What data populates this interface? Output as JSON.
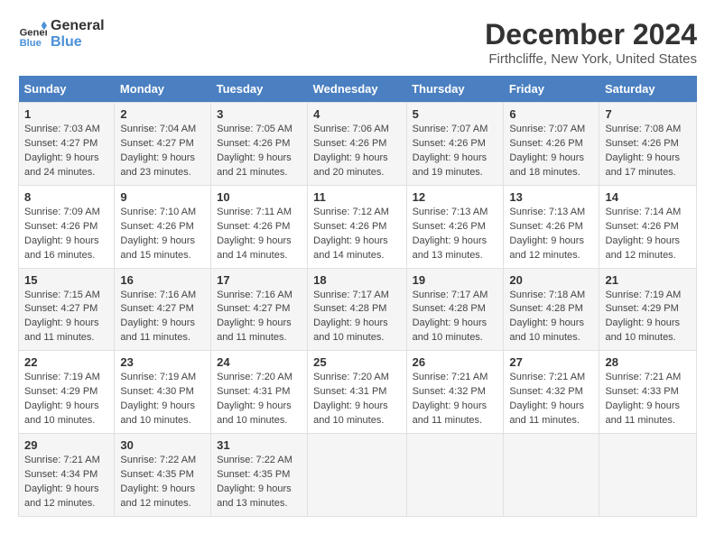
{
  "logo": {
    "line1": "General",
    "line2": "Blue"
  },
  "title": "December 2024",
  "subtitle": "Firthcliffe, New York, United States",
  "days_of_week": [
    "Sunday",
    "Monday",
    "Tuesday",
    "Wednesday",
    "Thursday",
    "Friday",
    "Saturday"
  ],
  "weeks": [
    [
      {
        "day": "1",
        "sunrise": "7:03 AM",
        "sunset": "4:27 PM",
        "daylight": "9 hours and 24 minutes."
      },
      {
        "day": "2",
        "sunrise": "7:04 AM",
        "sunset": "4:27 PM",
        "daylight": "9 hours and 23 minutes."
      },
      {
        "day": "3",
        "sunrise": "7:05 AM",
        "sunset": "4:26 PM",
        "daylight": "9 hours and 21 minutes."
      },
      {
        "day": "4",
        "sunrise": "7:06 AM",
        "sunset": "4:26 PM",
        "daylight": "9 hours and 20 minutes."
      },
      {
        "day": "5",
        "sunrise": "7:07 AM",
        "sunset": "4:26 PM",
        "daylight": "9 hours and 19 minutes."
      },
      {
        "day": "6",
        "sunrise": "7:07 AM",
        "sunset": "4:26 PM",
        "daylight": "9 hours and 18 minutes."
      },
      {
        "day": "7",
        "sunrise": "7:08 AM",
        "sunset": "4:26 PM",
        "daylight": "9 hours and 17 minutes."
      }
    ],
    [
      {
        "day": "8",
        "sunrise": "7:09 AM",
        "sunset": "4:26 PM",
        "daylight": "9 hours and 16 minutes."
      },
      {
        "day": "9",
        "sunrise": "7:10 AM",
        "sunset": "4:26 PM",
        "daylight": "9 hours and 15 minutes."
      },
      {
        "day": "10",
        "sunrise": "7:11 AM",
        "sunset": "4:26 PM",
        "daylight": "9 hours and 14 minutes."
      },
      {
        "day": "11",
        "sunrise": "7:12 AM",
        "sunset": "4:26 PM",
        "daylight": "9 hours and 14 minutes."
      },
      {
        "day": "12",
        "sunrise": "7:13 AM",
        "sunset": "4:26 PM",
        "daylight": "9 hours and 13 minutes."
      },
      {
        "day": "13",
        "sunrise": "7:13 AM",
        "sunset": "4:26 PM",
        "daylight": "9 hours and 12 minutes."
      },
      {
        "day": "14",
        "sunrise": "7:14 AM",
        "sunset": "4:26 PM",
        "daylight": "9 hours and 12 minutes."
      }
    ],
    [
      {
        "day": "15",
        "sunrise": "7:15 AM",
        "sunset": "4:27 PM",
        "daylight": "9 hours and 11 minutes."
      },
      {
        "day": "16",
        "sunrise": "7:16 AM",
        "sunset": "4:27 PM",
        "daylight": "9 hours and 11 minutes."
      },
      {
        "day": "17",
        "sunrise": "7:16 AM",
        "sunset": "4:27 PM",
        "daylight": "9 hours and 11 minutes."
      },
      {
        "day": "18",
        "sunrise": "7:17 AM",
        "sunset": "4:28 PM",
        "daylight": "9 hours and 10 minutes."
      },
      {
        "day": "19",
        "sunrise": "7:17 AM",
        "sunset": "4:28 PM",
        "daylight": "9 hours and 10 minutes."
      },
      {
        "day": "20",
        "sunrise": "7:18 AM",
        "sunset": "4:28 PM",
        "daylight": "9 hours and 10 minutes."
      },
      {
        "day": "21",
        "sunrise": "7:19 AM",
        "sunset": "4:29 PM",
        "daylight": "9 hours and 10 minutes."
      }
    ],
    [
      {
        "day": "22",
        "sunrise": "7:19 AM",
        "sunset": "4:29 PM",
        "daylight": "9 hours and 10 minutes."
      },
      {
        "day": "23",
        "sunrise": "7:19 AM",
        "sunset": "4:30 PM",
        "daylight": "9 hours and 10 minutes."
      },
      {
        "day": "24",
        "sunrise": "7:20 AM",
        "sunset": "4:31 PM",
        "daylight": "9 hours and 10 minutes."
      },
      {
        "day": "25",
        "sunrise": "7:20 AM",
        "sunset": "4:31 PM",
        "daylight": "9 hours and 10 minutes."
      },
      {
        "day": "26",
        "sunrise": "7:21 AM",
        "sunset": "4:32 PM",
        "daylight": "9 hours and 11 minutes."
      },
      {
        "day": "27",
        "sunrise": "7:21 AM",
        "sunset": "4:32 PM",
        "daylight": "9 hours and 11 minutes."
      },
      {
        "day": "28",
        "sunrise": "7:21 AM",
        "sunset": "4:33 PM",
        "daylight": "9 hours and 11 minutes."
      }
    ],
    [
      {
        "day": "29",
        "sunrise": "7:21 AM",
        "sunset": "4:34 PM",
        "daylight": "9 hours and 12 minutes."
      },
      {
        "day": "30",
        "sunrise": "7:22 AM",
        "sunset": "4:35 PM",
        "daylight": "9 hours and 12 minutes."
      },
      {
        "day": "31",
        "sunrise": "7:22 AM",
        "sunset": "4:35 PM",
        "daylight": "9 hours and 13 minutes."
      },
      null,
      null,
      null,
      null
    ]
  ],
  "labels": {
    "sunrise": "Sunrise:",
    "sunset": "Sunset:",
    "daylight": "Daylight:"
  }
}
